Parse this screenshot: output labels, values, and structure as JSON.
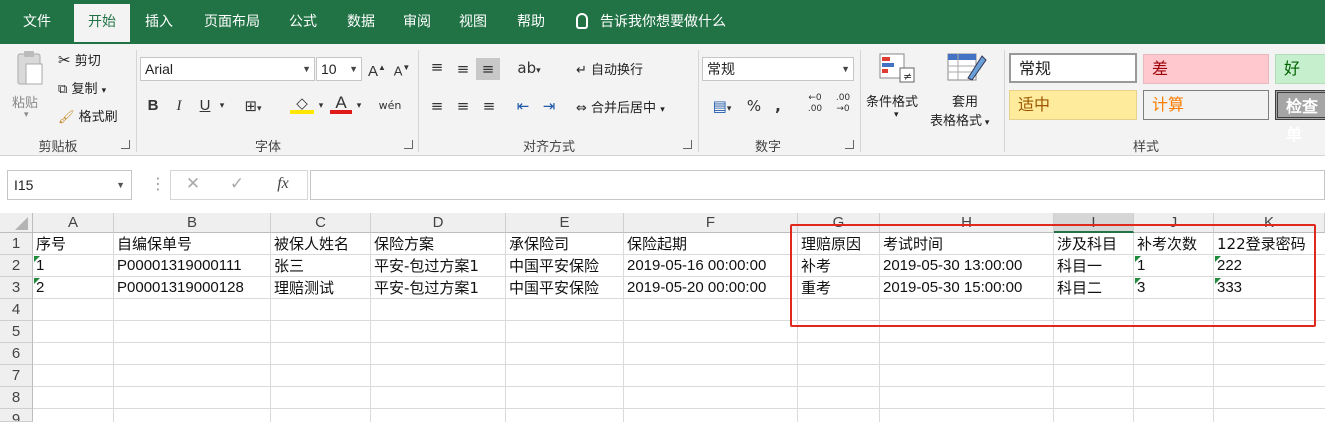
{
  "tabs": [
    "文件",
    "开始",
    "插入",
    "页面布局",
    "公式",
    "数据",
    "审阅",
    "视图",
    "帮助"
  ],
  "tell_me": "告诉我你想要做什么",
  "clipboard": {
    "paste": "粘贴",
    "cut": "剪切",
    "copy": "复制",
    "format_painter": "格式刷",
    "group": "剪贴板"
  },
  "font": {
    "name": "Arial",
    "size": "10",
    "bold": "B",
    "italic": "I",
    "underline": "U",
    "group": "字体"
  },
  "alignment": {
    "wrap": "自动换行",
    "merge": "合并后居中",
    "group": "对齐方式"
  },
  "number": {
    "format": "常规",
    "percent": "%",
    "comma": ",",
    "group": "数字"
  },
  "styles": {
    "conditional": "条件格式",
    "table_format_1": "套用",
    "table_format_2": "表格格式",
    "group": "样式",
    "cells": [
      "常规",
      "差",
      "好",
      "适中",
      "计算",
      "检查单"
    ],
    "colors": {
      "bad_bg": "#ffc7ce",
      "bad_fg": "#9c0006",
      "good_bg": "#c6efce",
      "good_fg": "#006100",
      "neutral_bg": "#ffeb9c",
      "neutral_fg": "#9c5700",
      "calc_bg": "#f2f2f2",
      "calc_fg": "#fa7d00",
      "check_bg": "#a5a5a5"
    }
  },
  "formula_bar": {
    "name_box": "I15",
    "fx": "fx",
    "cancel": "✕",
    "enter": "✓"
  },
  "columns": [
    "A",
    "B",
    "C",
    "D",
    "E",
    "F",
    "G",
    "H",
    "I",
    "J",
    "K"
  ],
  "rows": [
    "1",
    "2",
    "3",
    "4",
    "5",
    "6",
    "7",
    "8",
    "9"
  ],
  "header_row": [
    "序号",
    "自编保单号",
    "被保人姓名",
    "保险方案",
    "承保险司",
    "保险起期",
    "理赔原因",
    "考试时间",
    "涉及科目",
    "补考次数",
    "122登录密码"
  ],
  "data_rows": [
    [
      "1",
      "P00001319000111",
      "张三",
      "平安-包过方案1",
      "中国平安保险",
      "2019-05-16 00:00:00",
      "补考",
      "2019-05-30 13:00:00",
      "科目一",
      "1",
      "222"
    ],
    [
      "2",
      "P00001319000128",
      "理赔测试",
      "平安-包过方案1",
      "中国平安保险",
      "2019-05-20 00:00:00",
      "重考",
      "2019-05-30 15:00:00",
      "科目二",
      "3",
      "333"
    ]
  ],
  "accent": "#217346",
  "highlight_color": "#e0281e"
}
